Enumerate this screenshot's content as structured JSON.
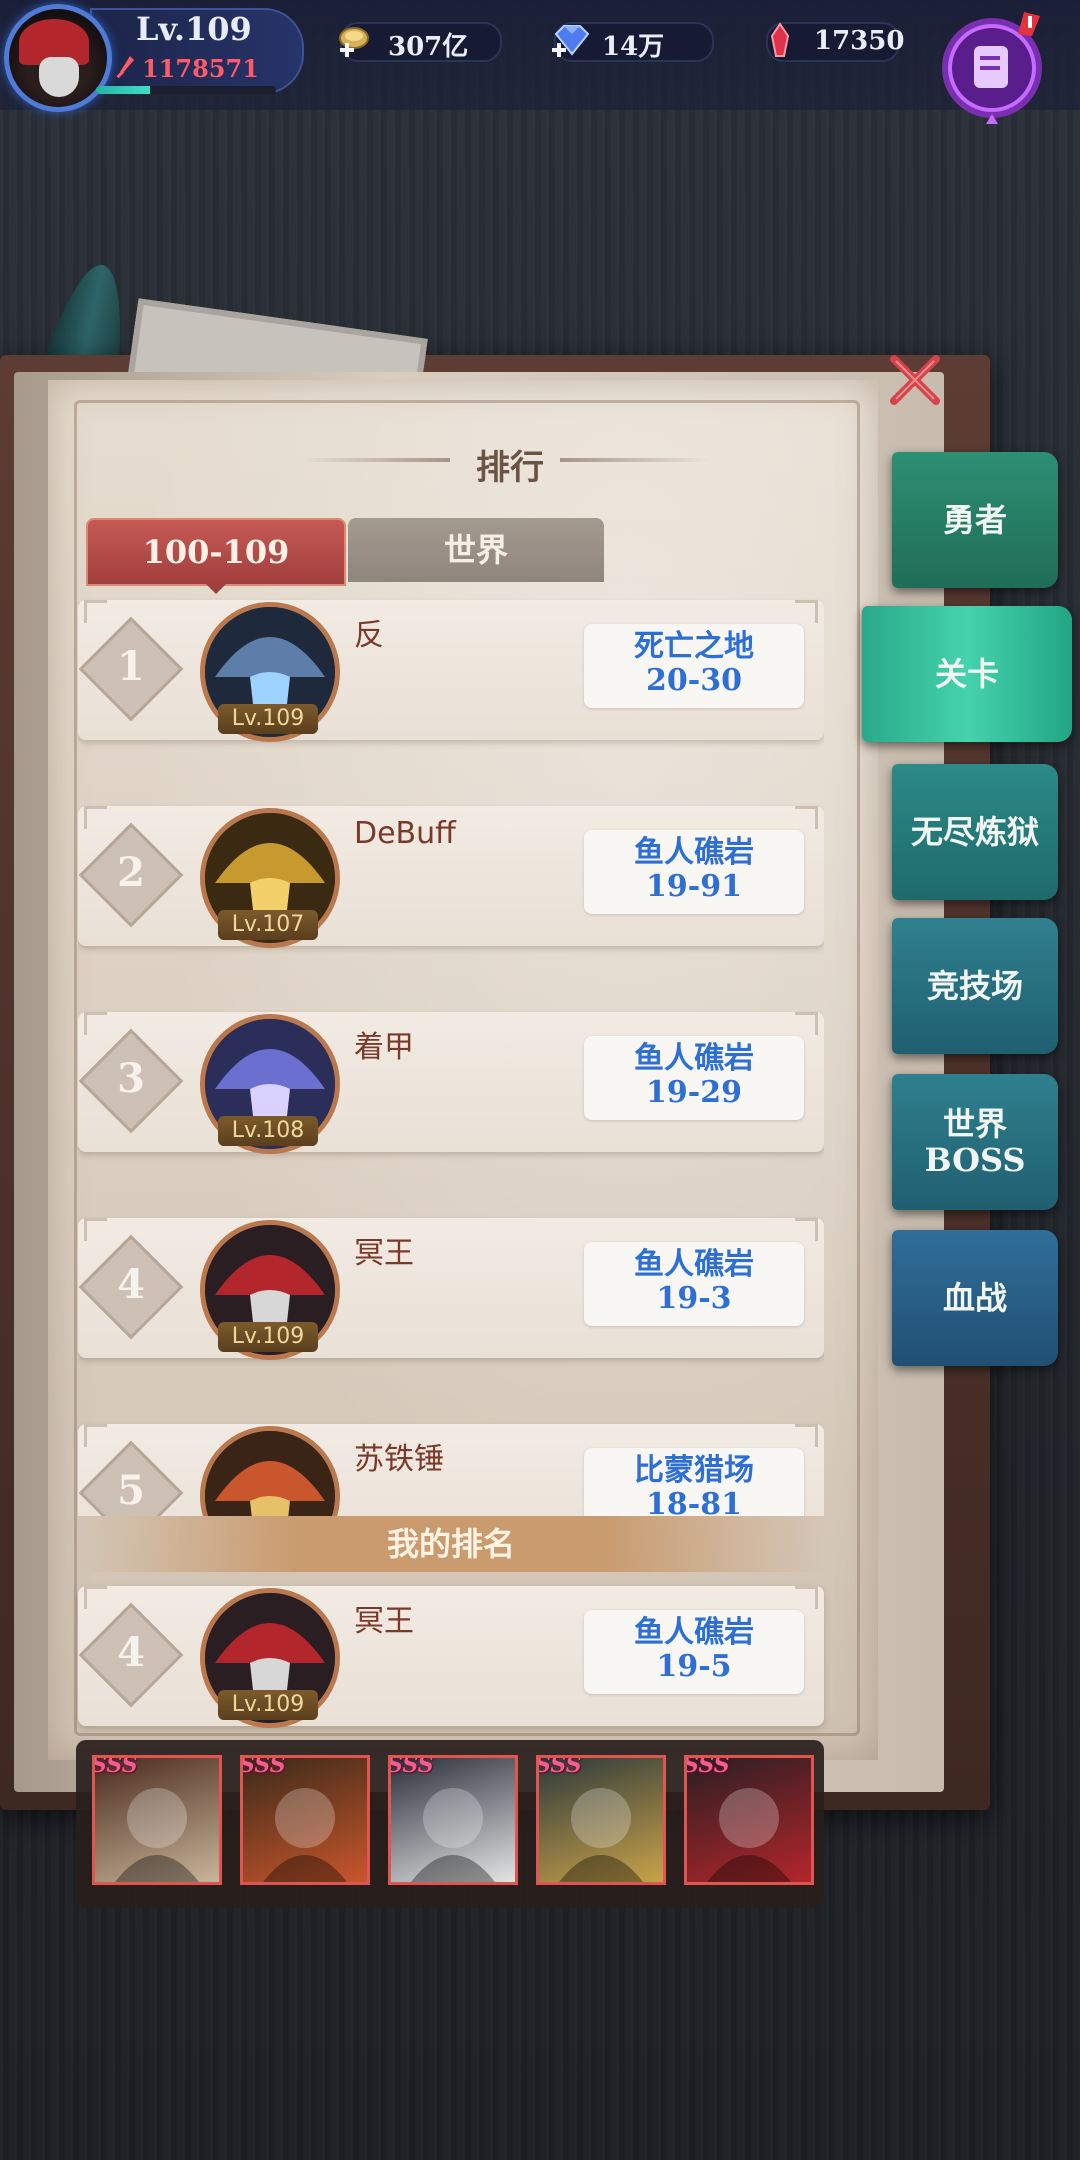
{
  "header": {
    "level": "Lv.109",
    "power": "1178571",
    "xp_fraction": 0.3,
    "gold": "307亿",
    "diamonds": "14万",
    "crystals": "17350"
  },
  "panel": {
    "title": "排行",
    "tab_range": "100-109",
    "tab_world": "世界"
  },
  "rankings": [
    {
      "rank": "1",
      "name": "反",
      "level": "Lv.109",
      "stage_name": "死亡之地",
      "stage_num": "20-30"
    },
    {
      "rank": "2",
      "name": "DeBuff",
      "level": "Lv.107",
      "stage_name": "鱼人礁岩",
      "stage_num": "19-91"
    },
    {
      "rank": "3",
      "name": "着甲",
      "level": "Lv.108",
      "stage_name": "鱼人礁岩",
      "stage_num": "19-29"
    },
    {
      "rank": "4",
      "name": "冥王",
      "level": "Lv.109",
      "stage_name": "鱼人礁岩",
      "stage_num": "19-3"
    },
    {
      "rank": "5",
      "name": "苏铁锤",
      "level": "",
      "stage_name": "比蒙猎场",
      "stage_num": "18-81"
    }
  ],
  "my_rank": {
    "header": "我的排名",
    "rank": "4",
    "name": "冥王",
    "level": "Lv.109",
    "stage_name": "鱼人礁岩",
    "stage_num": "19-5"
  },
  "team": [
    {
      "grade": "SSS"
    },
    {
      "grade": "SSS"
    },
    {
      "grade": "SSS"
    },
    {
      "grade": "SSS"
    },
    {
      "grade": "SSS"
    }
  ],
  "side_tabs": [
    {
      "label": "勇者"
    },
    {
      "label": "关卡"
    },
    {
      "label": "无尽炼狱"
    },
    {
      "label": "竞技场"
    },
    {
      "label": "世界BOSS"
    },
    {
      "label": "血战"
    }
  ],
  "colors": {
    "accent_red": "#a13f3d",
    "stage_blue": "#2e6fd6",
    "active_tab": "#44d3ad",
    "power_red": "#ff5a6a"
  }
}
